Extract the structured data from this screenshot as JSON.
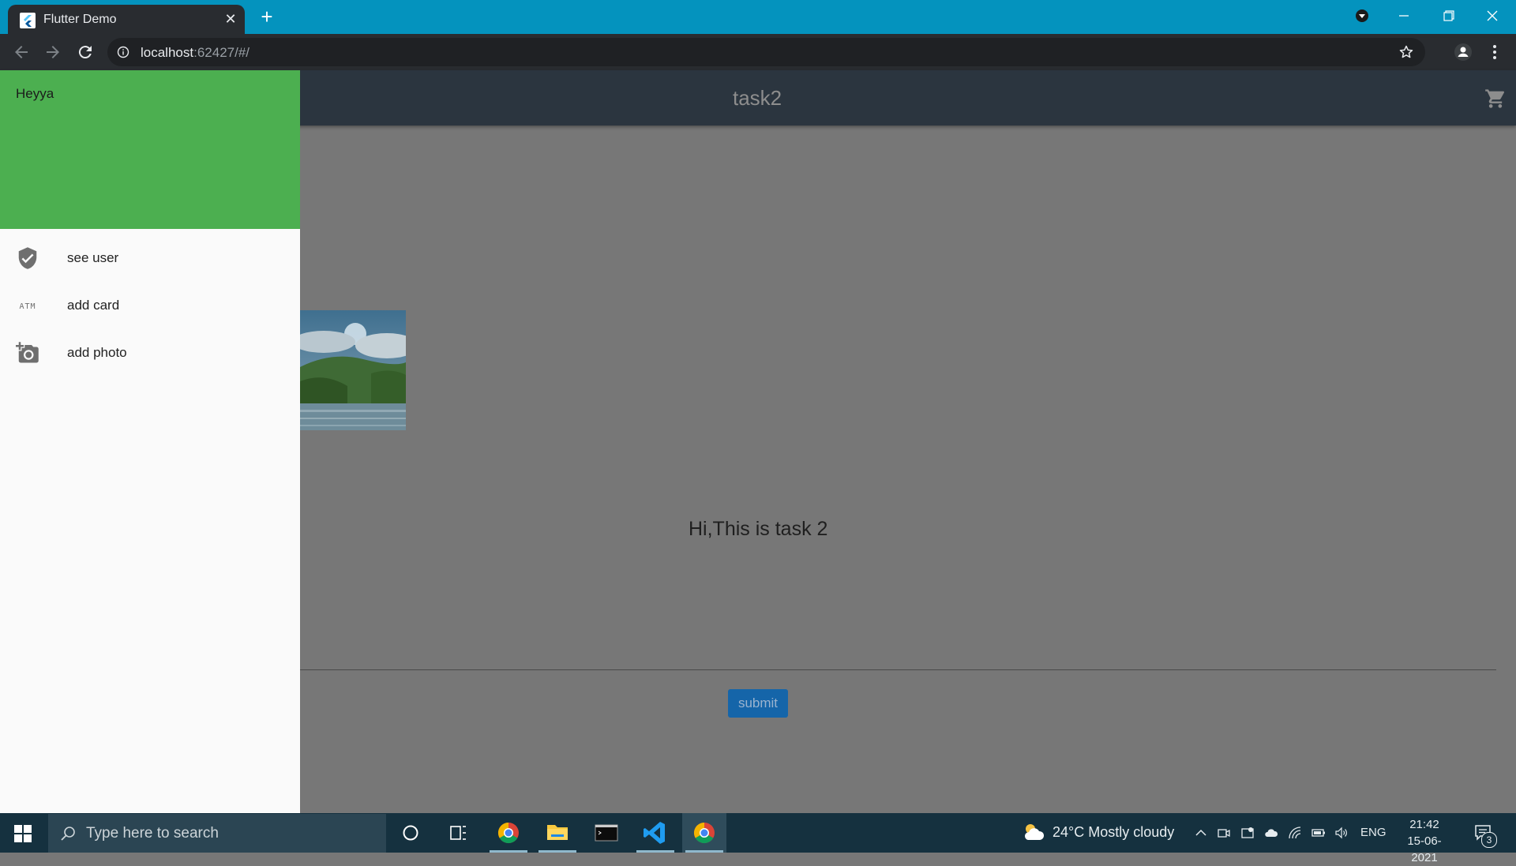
{
  "browser": {
    "tab_title": "Flutter Demo",
    "url_host": "localhost",
    "url_rest": ":62427/#/"
  },
  "app": {
    "title": "task2",
    "greeting": "Hi,This is task 2",
    "submit_label": "submit"
  },
  "drawer": {
    "header": "Heyya",
    "items": [
      {
        "label": "see user",
        "icon": "verified-user-icon"
      },
      {
        "label": "add card",
        "icon": "atm-icon"
      },
      {
        "label": "add photo",
        "icon": "add-a-photo-icon"
      }
    ]
  },
  "taskbar": {
    "search_placeholder": "Type here to search",
    "weather": "24°C  Mostly cloudy",
    "language": "ENG",
    "time": "21:42",
    "date": "15-06-2021",
    "notification_count": "3"
  },
  "colors": {
    "tabstrip": "#0493be",
    "drawer_header": "#4caf50",
    "appbar": "#2b353f",
    "submit_button": "#1565a9",
    "taskbar": "#15313f"
  }
}
